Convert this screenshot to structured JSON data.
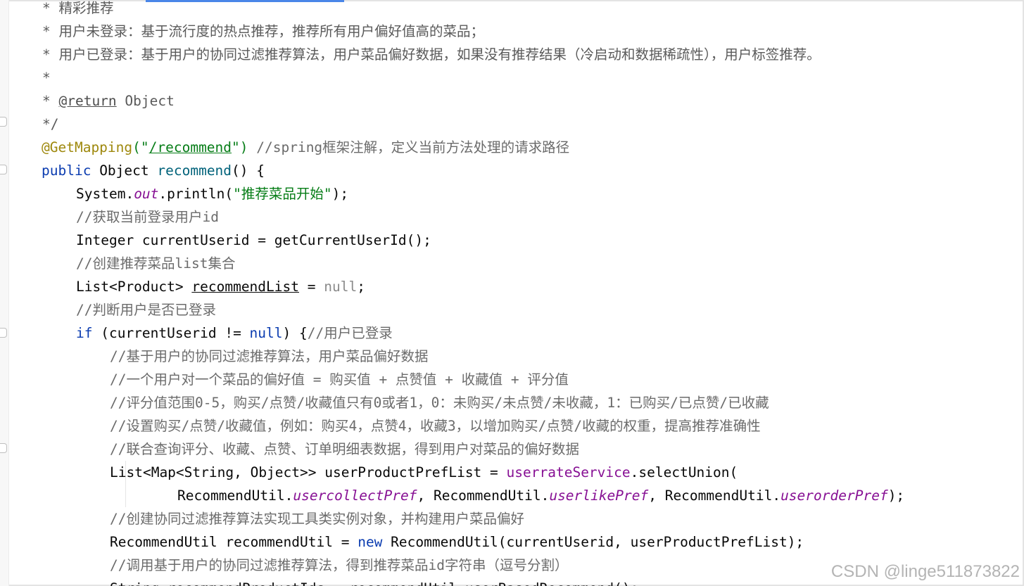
{
  "code": {
    "l1": "* 精彩推荐",
    "l2": "* 用户未登录：基于流行度的热点推荐，推荐所有用户偏好值高的菜品；",
    "l3": "* 用户已登录：基于用户的协同过滤推荐算法，用户菜品偏好数据，如果没有推荐结果（冷启动和数据稀疏性），用户标签推荐。",
    "l4": "*",
    "l5_star": "* ",
    "l5_tag": "@return",
    "l5_rest": " Object",
    "l6": "*/",
    "l7_anno": "@GetMapping",
    "l7_open": "(\"",
    "l7_path": "/recommend",
    "l7_close": "\")",
    "l7_comment": " //spring框架注解，定义当前方法处理的请求路径",
    "l8_kw": "public",
    "l8_type": " Object ",
    "l8_name": "recommend",
    "l8_rest": "() {",
    "l9_a": "System.",
    "l9_out": "out",
    "l9_b": ".println(",
    "l9_str": "\"推荐菜品开始\"",
    "l9_c": ");",
    "l10": "//获取当前登录用户id",
    "l11": "Integer currentUserid = getCurrentUserId();",
    "l12": "//创建推荐菜品list集合",
    "l13_a": "List<Product> ",
    "l13_var": "recommendList",
    "l13_b": " = ",
    "l13_null": "null",
    "l13_c": ";",
    "l14": "//判断用户是否已登录",
    "l15_if": "if",
    "l15_a": " (currentUserid != ",
    "l15_null": "null",
    "l15_b": ") {",
    "l15_comment": "//用户已登录",
    "l16": "//基于用户的协同过滤推荐算法，用户菜品偏好数据",
    "l17": "//一个用户对一个菜品的偏好值 = 购买值 + 点赞值 + 收藏值 + 评分值",
    "l18": "//评分值范围0-5，购买/点赞/收藏值只有0或者1，0：未购买/未点赞/未收藏，1：已购买/已点赞/已收藏",
    "l19": "//设置购买/点赞/收藏值，例如：购买4，点赞4，收藏3，以增加购买/点赞/收藏的权重，提高推荐准确性",
    "l20": "//联合查询评分、收藏、点赞、订单明细表数据，得到用户对菜品的偏好数据",
    "l21_a": "List<Map<String, Object>> userProductPrefList = ",
    "l21_field": "userrateService",
    "l21_b": ".selectUnion(",
    "l22_a": "RecommendUtil.",
    "l22_f1": "usercollectPref",
    "l22_b": ", RecommendUtil.",
    "l22_f2": "userlikePref",
    "l22_c": ", RecommendUtil.",
    "l22_f3": "userorderPref",
    "l22_d": ");",
    "l23": "//创建协同过滤推荐算法实现工具类实例对象，并构建用户菜品偏好",
    "l24_a": "RecommendUtil recommendUtil = ",
    "l24_new": "new",
    "l24_b": " RecommendUtil(currentUserid, userProductPrefList);",
    "l25": "//调用基于用户的协同过滤推荐算法，得到推荐菜品id字符串（逗号分割）",
    "l26": "String recommendProductIds = recommendUtil.userBasedRecommend();"
  },
  "watermark": "CSDN @linge511873822"
}
